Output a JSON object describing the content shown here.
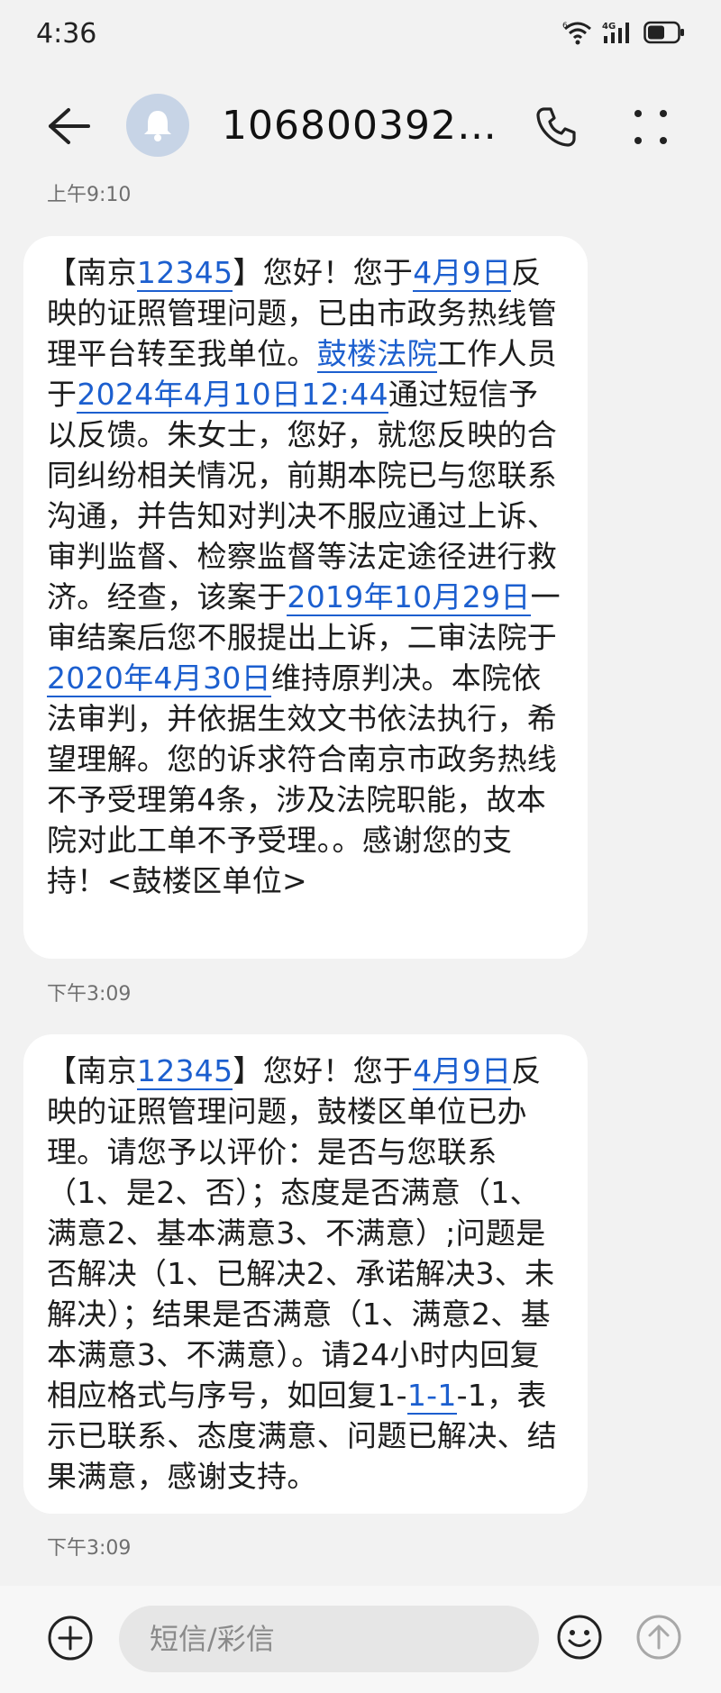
{
  "status_bar": {
    "time": "4:36",
    "wifi_label": "6",
    "network_label": "4G",
    "icons": [
      "wifi-6-icon",
      "signal-4g-icon",
      "battery-icon"
    ]
  },
  "header": {
    "contact": "1068003927…",
    "icons": [
      "back-arrow-icon",
      "bell-avatar-icon",
      "phone-icon",
      "more-dots-icon"
    ]
  },
  "messages": [
    {
      "timestamp": "上午9:10",
      "segments": [
        {
          "t": "【南京"
        },
        {
          "t": "12345",
          "link": true
        },
        {
          "t": "】您好！您于"
        },
        {
          "t": "4月9日",
          "link": true
        },
        {
          "t": "反映的证照管理问题，已由市政务热线管理平台转至我单位。"
        },
        {
          "t": "鼓楼法院",
          "link": true
        },
        {
          "t": "工作人员于"
        },
        {
          "t": "2024年4月10日12:44",
          "link": true
        },
        {
          "t": "通过短信予以反馈。朱女士，您好，就您反映的合同纠纷相关情况，前期本院已与您联系沟通，并告知对判决不服应通过上诉、审判监督、检察监督等法定途径进行救济。经查，该案于"
        },
        {
          "t": "2019年10月29日",
          "link": true
        },
        {
          "t": "一审结案后您不服提出上诉，二审法院于"
        },
        {
          "t": "2020年4月30日",
          "link": true
        },
        {
          "t": "维持原判决。本院依法审判，并依据生效文书依法执行，希望理解。您的诉求符合南京市政务热线不予受理第4条，涉及法院职能，故本院对此工单不予受理。。感谢您的支持！<鼓楼区单位>"
        }
      ]
    },
    {
      "timestamp": "下午3:09",
      "segments": [
        {
          "t": "【南京"
        },
        {
          "t": "12345",
          "link": true
        },
        {
          "t": "】您好！您于"
        },
        {
          "t": "4月9日",
          "link": true
        },
        {
          "t": "反映的证照管理问题，鼓楼区单位已办理。请您予以评价：是否与您联系（1、是2、否）；态度是否满意（1、满意2、基本满意3、不满意）;问题是否解决（1、已解决2、承诺解决3、未解决）；结果是否满意（1、满意2、基本满意3、不满意）。请24小时内回复相应格式与序号，如回复1-"
        },
        {
          "t": "1-1",
          "link": true
        },
        {
          "t": "-1，表示已联系、态度满意、问题已解决、结果满意，感谢支持。"
        }
      ]
    }
  ],
  "last_timestamp": "下午3:09",
  "input_bar": {
    "placeholder": "短信/彩信",
    "icons": [
      "add-icon",
      "emoji-icon",
      "send-icon"
    ]
  },
  "colors": {
    "background": "#f2f2f2",
    "bubble": "#ffffff",
    "link": "#1c5fcf",
    "avatar": "#c7d4e6"
  }
}
